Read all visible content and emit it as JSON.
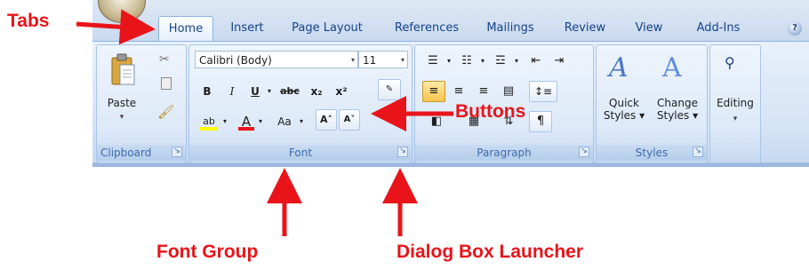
{
  "tabs": [
    {
      "label": "Home",
      "active": true
    },
    {
      "label": "Insert",
      "active": false
    },
    {
      "label": "Page Layout",
      "active": false
    },
    {
      "label": "References",
      "active": false
    },
    {
      "label": "Mailings",
      "active": false
    },
    {
      "label": "Review",
      "active": false
    },
    {
      "label": "View",
      "active": false
    },
    {
      "label": "Add-Ins",
      "active": false
    }
  ],
  "groups": {
    "clipboard": {
      "label": "Clipboard",
      "paste_label": "Paste"
    },
    "font": {
      "label": "Font",
      "font_name": "Calibri (Body)",
      "font_size": "11",
      "bold": "B",
      "italic": "I",
      "underline": "U",
      "strikethrough": "abc",
      "subscript": "x₂",
      "superscript": "x²",
      "highlight": "ab",
      "font_color": "A",
      "change_case": "Aa",
      "grow_font": "A˄",
      "shrink_font": "A˅"
    },
    "paragraph": {
      "label": "Paragraph"
    },
    "styles": {
      "label": "Styles",
      "quick_styles_line1": "Quick",
      "quick_styles_line2": "Styles",
      "change_styles_line1": "Change",
      "change_styles_line2": "Styles"
    },
    "editing": {
      "label": "Editing"
    }
  },
  "annotations": {
    "tabs": "Tabs",
    "buttons": "Buttons",
    "font_group": "Font Group",
    "dialog_box_launcher": "Dialog Box Launcher"
  },
  "colors": {
    "annotation_red": "#e8141a",
    "ribbon_blue": "#d4e3f5",
    "tab_text": "#15428b",
    "font_color_bar": "#e8141a",
    "highlight_bar": "#ffff00"
  }
}
